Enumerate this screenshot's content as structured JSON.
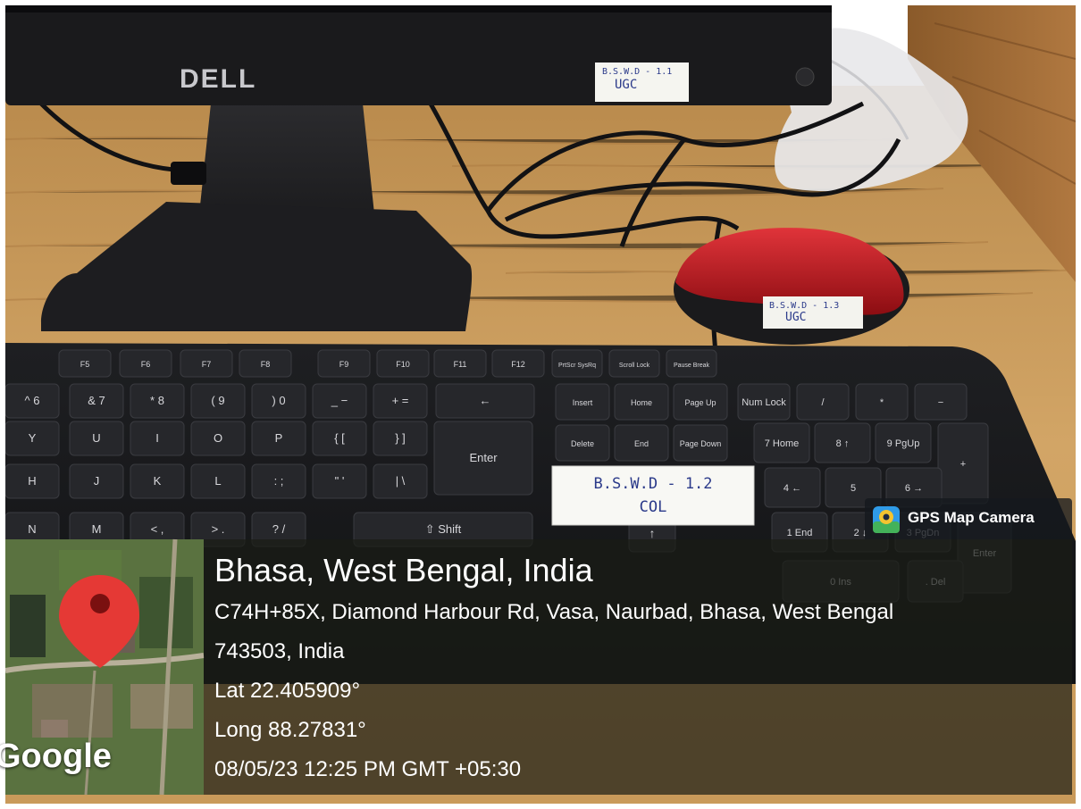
{
  "photo": {
    "monitor_brand": "DELL",
    "label_monitor": {
      "line1": "B.S.W.D - 1.1",
      "line2": "UGC"
    },
    "label_mouse": {
      "line1": "B.S.W.D - 1.3",
      "line2": "UGC"
    },
    "label_keyboard": {
      "line1": "B.S.W.D - 1.2",
      "line2": "COL"
    }
  },
  "keyboard": {
    "function_keys": [
      "F5",
      "F6",
      "F7",
      "F8",
      "F9",
      "F10",
      "F11",
      "F12",
      "PrtScr SysRq",
      "Scroll Lock",
      "Pause Break"
    ],
    "nav_keys": [
      "Insert",
      "Home",
      "Page Up",
      "Delete",
      "End",
      "Page Down"
    ],
    "numpad_keys": [
      "Num Lock",
      "/",
      "*",
      "−",
      "7 Home",
      "8 ↑",
      "9 PgUp",
      "+",
      "4 ←",
      "5",
      "6 →",
      "1 End",
      "2 ↓",
      "3 PgDn",
      "Enter",
      "0 Ins",
      ". Del"
    ],
    "letter_keys": [
      "^ 6",
      "& 7",
      "* 8",
      "( 9",
      ") 0",
      "_ −",
      "+ =",
      "←",
      "Y",
      "U",
      "I",
      "O",
      "P",
      "{ [",
      "} ]",
      "Enter",
      "H",
      "J",
      "K",
      "L",
      ": ;",
      "\" '",
      "| \\",
      "N",
      "M",
      "< ,",
      "> .",
      "? /",
      "⇧ Shift"
    ]
  },
  "gps_badge": {
    "icon": "camera-location-icon",
    "label": "GPS Map Camera"
  },
  "location": {
    "title": "Bhasa, West Bengal, India",
    "address_line1": "C74H+85X, Diamond Harbour Rd, Vasa, Naurbad, Bhasa, West Bengal",
    "address_line2": "743503, India",
    "lat": "Lat 22.405909°",
    "long": "Long 88.27831°",
    "datetime": "08/05/23 12:25 PM GMT +05:30"
  },
  "map": {
    "attribution": "Google",
    "pin_icon": "map-pin-icon"
  },
  "colors": {
    "pin": "#e53935",
    "overlay": "#1a1c16",
    "mouse": "#c4161c",
    "desk": "#c9a063"
  }
}
